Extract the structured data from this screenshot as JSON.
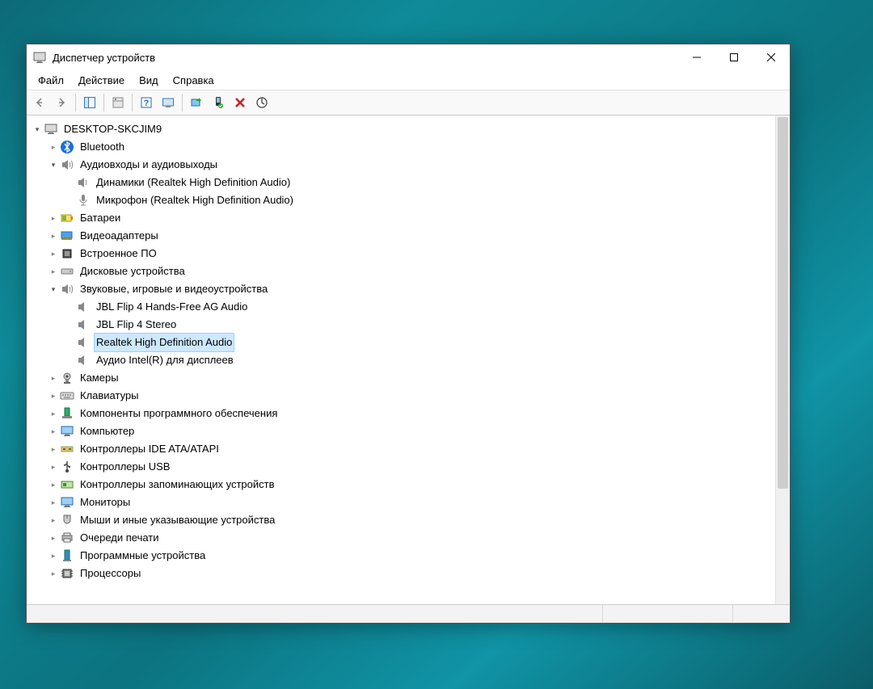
{
  "window": {
    "title": "Диспетчер устройств"
  },
  "menu": {
    "file": "Файл",
    "action": "Действие",
    "view": "Вид",
    "help": "Справка"
  },
  "root": "DESKTOP-SKCJIM9",
  "cat": {
    "bluetooth": "Bluetooth",
    "audio_io": "Аудиовходы и аудиовыходы",
    "audio_io_c": {
      "speakers": "Динамики (Realtek High Definition Audio)",
      "mic": "Микрофон (Realtek High Definition Audio)"
    },
    "batteries": "Батареи",
    "display": "Видеоадаптеры",
    "firmware": "Встроенное ПО",
    "disks": "Дисковые устройства",
    "sound": "Звуковые, игровые и видеоустройства",
    "sound_c": {
      "jbl_hf": "JBL Flip 4 Hands-Free AG Audio",
      "jbl_st": "JBL Flip 4 Stereo",
      "realtek": "Realtek High Definition Audio",
      "intel": "Аудио Intel(R) для дисплеев"
    },
    "cameras": "Камеры",
    "keyboards": "Клавиатуры",
    "software": "Компоненты программного обеспечения",
    "computer": "Компьютер",
    "ide": "Контроллеры IDE ATA/ATAPI",
    "usb": "Контроллеры USB",
    "storage_ctrl": "Контроллеры запоминающих устройств",
    "monitors": "Мониторы",
    "mice": "Мыши и иные указывающие устройства",
    "print": "Очереди печати",
    "softdev": "Программные устройства",
    "cpu": "Процессоры"
  }
}
